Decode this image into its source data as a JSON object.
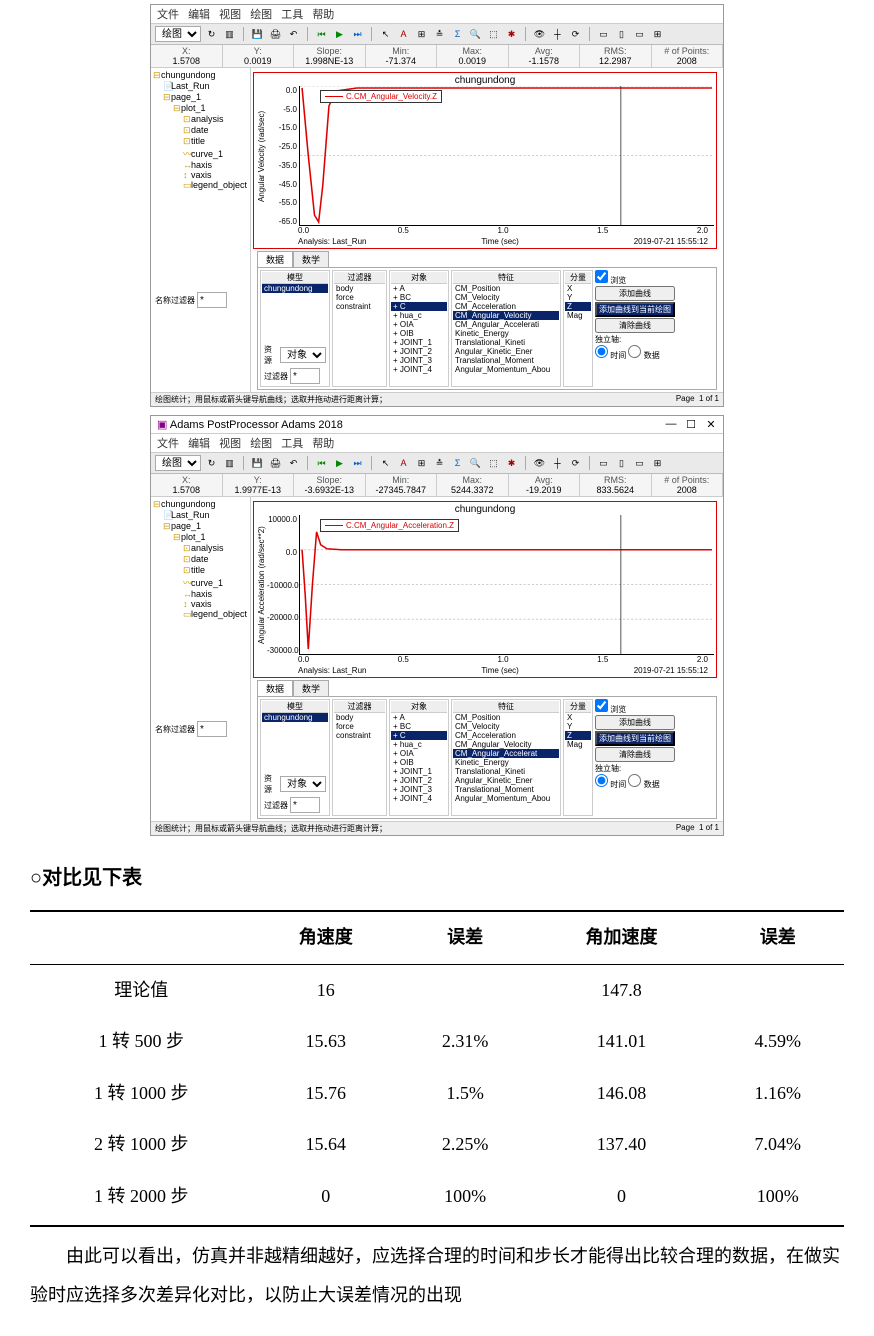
{
  "window1": {
    "menubar": [
      "文件",
      "编辑",
      "视图",
      "绘图",
      "工具",
      "帮助"
    ],
    "dropdown": "绘图",
    "stats": {
      "X": "1.5708",
      "Y": "0.0019",
      "Slope": "1.998NE-13",
      "Min": "-71.374",
      "Max": "0.0019",
      "Avg": "-1.1578",
      "RMS": "12.2987",
      "Points": "2008"
    },
    "tree": [
      "chungundong",
      "Last_Run",
      "page_1",
      "plot_1",
      "analysis",
      "date",
      "title",
      "curve_1",
      "haxis",
      "vaxis",
      "legend_object"
    ],
    "plot": {
      "title": "chungundong",
      "legend": "C.CM_Angular_Velocity.Z",
      "ylabel": "Angular Velocity (rad/sec)",
      "xlabel": "Time (sec)",
      "analysis": "Analysis: Last_Run",
      "timestamp": "2019-07-21 15:55:12",
      "yticks": [
        "0.0",
        "-5.0",
        "-15.0",
        "-25.0",
        "-35.0",
        "-45.0",
        "-55.0",
        "-65.0"
      ],
      "xticks": [
        "0.0",
        "0.5",
        "1.0",
        "1.5",
        "2.0"
      ]
    },
    "tabs": [
      "数据",
      "数学"
    ],
    "browse": {
      "col1_hdr": "模型",
      "col1_items": [
        "chungundong"
      ],
      "col2_hdr": "过滤器",
      "col2_items": [
        "body",
        "force",
        "constraint"
      ],
      "col3_hdr": "对象",
      "col3_items": [
        "+ A",
        "+ BC",
        "+ C",
        "+ hua_c",
        "+ OIA",
        "+ OIB",
        "+ JOINT_1",
        "+ JOINT_2",
        "+ JOINT_3",
        "+ JOINT_4"
      ],
      "col4_hdr": "特征",
      "col4_items": [
        "CM_Position",
        "CM_Velocity",
        "CM_Acceleration",
        "CM_Angular_Velocity",
        "CM_Angular_Accelerati",
        "Kinetic_Energy",
        "Translational_Kineti",
        "Angular_Kinetic_Ener",
        "Translational_Moment",
        "Angular_Momentum_Abou"
      ],
      "col5_hdr": "分量",
      "col5_items": [
        "X",
        "Y",
        "Z",
        "Mag"
      ],
      "right": {
        "surf": "浏览",
        "add_curve": "添加曲线",
        "add_to_plot": "添加曲线到当前绘图",
        "clear": "清除曲线",
        "indep": "独立轴:",
        "time": "时间",
        "data": "数据"
      },
      "src_label": "资源",
      "src_val": "对象",
      "flt_label": "过滤器",
      "flt_val": "*"
    },
    "name_filter_label": "名称过滤器",
    "name_filter_val": "*",
    "status_left": "绘图统计；用鼠标或箭头键导航曲线；选取并拖动进行距离计算；",
    "status_right_page": "Page",
    "status_right_of": "1 of 1"
  },
  "window2": {
    "title": "Adams PostProcessor Adams 2018",
    "menubar": [
      "文件",
      "编辑",
      "视图",
      "绘图",
      "工具",
      "帮助"
    ],
    "dropdown": "绘图",
    "stats": {
      "X": "1.5708",
      "Y": "1.9977E-13",
      "Slope": "-3.6932E-13",
      "Min": "-27345.7847",
      "Max": "5244.3372",
      "Avg": "-19.2019",
      "RMS": "833.5624",
      "Points": "2008"
    },
    "tree": [
      "chungundong",
      "Last_Run",
      "page_1",
      "plot_1",
      "analysis",
      "date",
      "title",
      "curve_1",
      "haxis",
      "vaxis",
      "legend_object"
    ],
    "plot": {
      "title": "chungundong",
      "legend": "C.CM_Angular_Acceleration.Z",
      "ylabel": "Angular Acceleration (rad/sec**2)",
      "xlabel": "Time (sec)",
      "analysis": "Analysis: Last_Run",
      "timestamp": "2019-07-21 15:55:12",
      "yticks": [
        "10000.0",
        "0.0",
        "-10000.0",
        "-20000.0",
        "-30000.0"
      ],
      "xticks": [
        "0.0",
        "0.5",
        "1.0",
        "1.5",
        "2.0"
      ]
    },
    "tabs": [
      "数据",
      "数学"
    ],
    "browse": {
      "col1_hdr": "模型",
      "col1_items": [
        "chungundong"
      ],
      "col2_hdr": "过滤器",
      "col2_items": [
        "body",
        "force",
        "constraint"
      ],
      "col3_hdr": "对象",
      "col3_items": [
        "+ A",
        "+ BC",
        "+ C",
        "+ hua_c",
        "+ OIA",
        "+ OIB",
        "+ JOINT_1",
        "+ JOINT_2",
        "+ JOINT_3",
        "+ JOINT_4"
      ],
      "col4_hdr": "特征",
      "col4_items": [
        "CM_Position",
        "CM_Velocity",
        "CM_Acceleration",
        "CM_Angular_Velocity",
        "CM_Angular_Accelerat",
        "Kinetic_Energy",
        "Translational_Kineti",
        "Angular_Kinetic_Ener",
        "Translational_Moment",
        "Angular_Momentum_Abou"
      ],
      "col5_hdr": "分量",
      "col5_items": [
        "X",
        "Y",
        "Z",
        "Mag"
      ],
      "right": {
        "surf": "浏览",
        "add_curve": "添加曲线",
        "add_to_plot": "添加曲线到当前绘图",
        "clear": "清除曲线",
        "indep": "独立轴:",
        "time": "时间",
        "data": "数据"
      },
      "src_label": "资源",
      "src_val": "对象",
      "flt_label": "过滤器",
      "flt_val": "*"
    },
    "name_filter_label": "名称过滤器",
    "name_filter_val": "*",
    "status_left": "绘图统计；用鼠标或箭头键导航曲线；选取并拖动进行距离计算；",
    "status_right_page": "Page",
    "status_right_of": "1 of 1"
  },
  "chart_data": [
    {
      "type": "line",
      "title": "chungundong",
      "series": [
        {
          "name": "C.CM_Angular_Velocity.Z",
          "x": [
            0.0,
            0.02,
            0.05,
            0.08,
            0.11,
            0.15,
            0.5,
            1.0,
            1.5,
            1.57,
            2.0
          ],
          "y": [
            0.0,
            -35,
            -68,
            -71.37,
            -45,
            -5,
            0.0,
            0.0,
            0.0,
            0.0019,
            0.0
          ]
        }
      ],
      "xlabel": "Time (sec)",
      "ylabel": "Angular Velocity (rad/sec)",
      "ylim": [
        -71.374,
        0.0
      ],
      "xlim": [
        0,
        2.0
      ]
    },
    {
      "type": "line",
      "title": "chungundong",
      "series": [
        {
          "name": "C.CM_Angular_Acceleration.Z",
          "x": [
            0.0,
            0.02,
            0.05,
            0.08,
            0.12,
            0.14,
            0.16,
            0.5,
            1.0,
            1.5,
            1.57,
            2.0
          ],
          "y": [
            0,
            -15000,
            -27345.78,
            -5000,
            5244.34,
            2000,
            0,
            0,
            0,
            0,
            0,
            0
          ]
        }
      ],
      "xlabel": "Time (sec)",
      "ylabel": "Angular Acceleration (rad/sec**2)",
      "ylim": [
        -30000,
        10000
      ],
      "xlim": [
        0,
        2.0
      ]
    }
  ],
  "doc": {
    "heading": "○对比见下表",
    "table": {
      "headers": [
        "",
        "角速度",
        "误差",
        "角加速度",
        "误差"
      ],
      "rows": [
        [
          "理论值",
          "16",
          "",
          "147.8",
          ""
        ],
        [
          "1 转 500 步",
          "15.63",
          "2.31%",
          "141.01",
          "4.59%"
        ],
        [
          "1 转 1000 步",
          "15.76",
          "1.5%",
          "146.08",
          "1.16%"
        ],
        [
          "2 转 1000 步",
          "15.64",
          "2.25%",
          "137.40",
          "7.04%"
        ],
        [
          "1 转 2000 步",
          "0",
          "100%",
          "0",
          "100%"
        ]
      ]
    },
    "para": "由此可以看出，仿真并非越精细越好，应选择合理的时间和步长才能得出比较合理的数据，在做实验时应选择多次差异化对比，以防止大误差情况的出现"
  }
}
